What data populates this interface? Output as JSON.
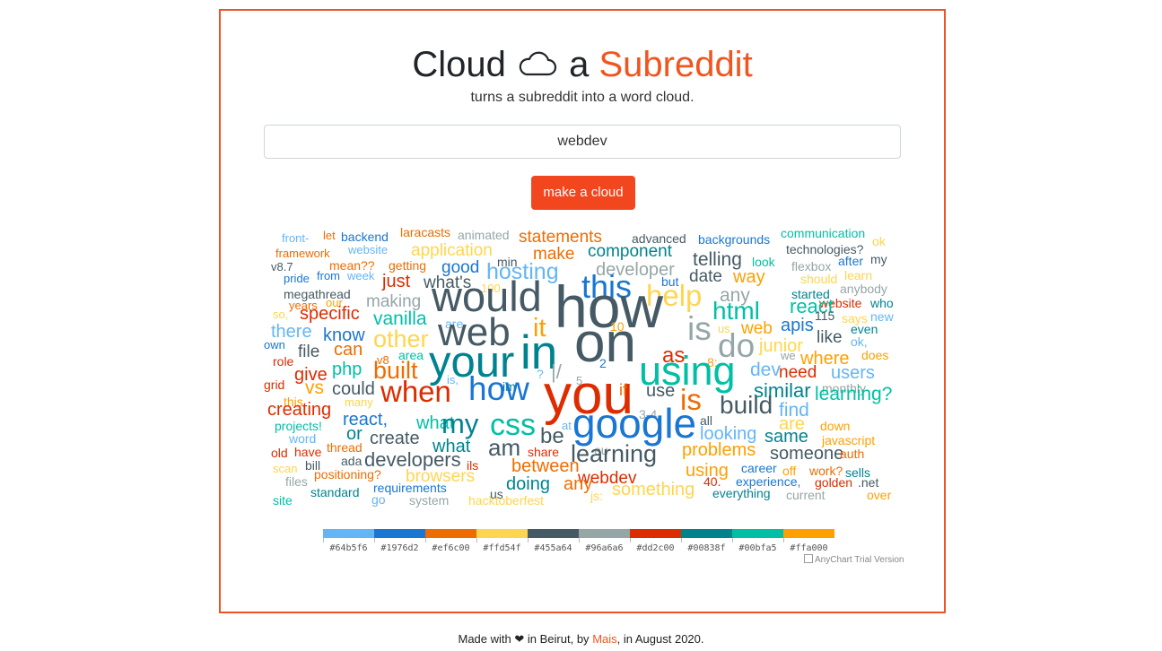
{
  "header": {
    "title_prefix": "Cloud",
    "title_mid": "a",
    "title_accent": "Subreddit",
    "cloud_icon": "cloud-icon",
    "subtitle": "turns a subreddit into a word cloud."
  },
  "search": {
    "value": "webdev"
  },
  "make_button_label": "make a cloud",
  "colors": {
    "accent": "#ef5223",
    "button": "#f1461e",
    "palette": [
      "#64b5f6",
      "#1976d2",
      "#ef6c00",
      "#ffd54f",
      "#455a64",
      "#96a6a6",
      "#dd2c00",
      "#00838f",
      "#00bfa5",
      "#ffa000"
    ]
  },
  "legend": {
    "labels": [
      "#64b5f6",
      "#1976d2",
      "#ef6c00",
      "#ffd54f",
      "#455a64",
      "#96a6a6",
      "#dd2c00",
      "#00838f",
      "#00bfa5",
      "#ffa000"
    ],
    "credit": "AnyChart Trial Version"
  },
  "word_cloud": [
    {
      "t": "front-",
      "c": "#64b5f6"
    },
    {
      "t": "framework",
      "c": "#ef6c00"
    },
    {
      "t": "let",
      "c": "#ef6c00"
    },
    {
      "t": "backend",
      "c": "#1976d2"
    },
    {
      "t": "website",
      "c": "#64b5f6"
    },
    {
      "t": "laracasts",
      "c": "#ef6c00"
    },
    {
      "t": "animated",
      "c": "#96a6a6"
    },
    {
      "t": "statements",
      "c": "#ef6c00"
    },
    {
      "t": "advanced",
      "c": "#455a64"
    },
    {
      "t": "backgrounds",
      "c": "#1976d2"
    },
    {
      "t": "communication",
      "c": "#00bfa5"
    },
    {
      "t": "ok",
      "c": "#ffd54f"
    },
    {
      "t": "application",
      "c": "#ffd54f"
    },
    {
      "t": "make",
      "c": "#ef6c00"
    },
    {
      "t": "component",
      "c": "#00838f"
    },
    {
      "t": "technologies?",
      "c": "#455a64"
    },
    {
      "t": "my",
      "c": "#455a64"
    },
    {
      "t": "v8.7",
      "c": "#455a64"
    },
    {
      "t": "mean??",
      "c": "#ef6c00"
    },
    {
      "t": "getting",
      "c": "#ef6c00"
    },
    {
      "t": "min",
      "c": "#455a64"
    },
    {
      "t": "telling",
      "c": "#455a64"
    },
    {
      "t": "look",
      "c": "#00bfa5"
    },
    {
      "t": "after",
      "c": "#1976d2"
    },
    {
      "t": "pride",
      "c": "#1976d2"
    },
    {
      "t": "from",
      "c": "#1976d2"
    },
    {
      "t": "week",
      "c": "#64b5f6"
    },
    {
      "t": "good",
      "c": "#1976d2"
    },
    {
      "t": "hosting",
      "c": "#64b5f6"
    },
    {
      "t": "developer",
      "c": "#96a6a6"
    },
    {
      "t": "flexbox",
      "c": "#96a6a6"
    },
    {
      "t": "learn",
      "c": "#ffd54f"
    },
    {
      "t": "just",
      "c": "#dd2c00"
    },
    {
      "t": "what's",
      "c": "#455a64"
    },
    {
      "t": "100",
      "c": "#ffd54f"
    },
    {
      "t": "date",
      "c": "#455a64"
    },
    {
      "t": "way",
      "c": "#ffa000"
    },
    {
      "t": "should",
      "c": "#ffd54f"
    },
    {
      "t": "megathread",
      "c": "#455a64"
    },
    {
      "t": "this",
      "c": "#1976d2"
    },
    {
      "t": "but",
      "c": "#1976d2"
    },
    {
      "t": "anybody",
      "c": "#96a6a6"
    },
    {
      "t": "years",
      "c": "#ef6c00"
    },
    {
      "t": "our",
      "c": "#ffa000"
    },
    {
      "t": "making",
      "c": "#96a6a6"
    },
    {
      "t": "would",
      "c": "#455a64"
    },
    {
      "t": "help",
      "c": "#ffd54f"
    },
    {
      "t": "any",
      "c": "#96a6a6"
    },
    {
      "t": "started",
      "c": "#00838f"
    },
    {
      "t": "website",
      "c": "#dd2c00"
    },
    {
      "t": "who",
      "c": "#00838f"
    },
    {
      "t": "so,",
      "c": "#ffd54f"
    },
    {
      "t": "specific",
      "c": "#dd2c00"
    },
    {
      "t": "vanilla",
      "c": "#00bfa5"
    },
    {
      "t": "html",
      "c": "#00bfa5"
    },
    {
      "t": "react",
      "c": "#00bfa5"
    },
    {
      "t": "115",
      "c": "#455a64"
    },
    {
      "t": "says",
      "c": "#ffd54f"
    },
    {
      "t": "new",
      "c": "#64b5f6"
    },
    {
      "t": "there",
      "c": "#64b5f6"
    },
    {
      "t": "are",
      "c": "#64b5f6"
    },
    {
      "t": "how",
      "c": "#455a64"
    },
    {
      "t": "10",
      "c": "#ffa000"
    },
    {
      "t": "us",
      "c": "#ffd54f"
    },
    {
      "t": "web",
      "c": "#ffa000"
    },
    {
      "t": "apis",
      "c": "#1976d2"
    },
    {
      "t": "even",
      "c": "#00838f"
    },
    {
      "t": "know",
      "c": "#1976d2"
    },
    {
      "t": "other",
      "c": "#ffd54f"
    },
    {
      "t": "web",
      "c": "#455a64"
    },
    {
      "t": "it",
      "c": "#ffa000"
    },
    {
      "t": "is",
      "c": "#96a6a6"
    },
    {
      "t": "like",
      "c": "#455a64"
    },
    {
      "t": "ok,",
      "c": "#64b5f6"
    },
    {
      "t": "own",
      "c": "#1976d2"
    },
    {
      "t": "file",
      "c": "#455a64"
    },
    {
      "t": "can",
      "c": "#ef6c00"
    },
    {
      "t": "junior",
      "c": "#ffd54f"
    },
    {
      "t": "do",
      "c": "#96a6a6"
    },
    {
      "t": "on",
      "c": "#455a64"
    },
    {
      "t": "in",
      "c": "#00838f"
    },
    {
      "t": "we",
      "c": "#96a6a6"
    },
    {
      "t": "does",
      "c": "#ffa000"
    },
    {
      "t": "role",
      "c": "#dd2c00"
    },
    {
      "t": "area",
      "c": "#00bfa5"
    },
    {
      "t": "v8",
      "c": "#ef6c00"
    },
    {
      "t": "as",
      "c": "#dd2c00"
    },
    {
      "t": "where",
      "c": "#ffa000"
    },
    {
      "t": "8:",
      "c": "#ffa000"
    },
    {
      "t": "built",
      "c": "#ef6c00"
    },
    {
      "t": "php",
      "c": "#00bfa5"
    },
    {
      "t": "your",
      "c": "#00838f"
    },
    {
      "t": "2",
      "c": "#1976d2"
    },
    {
      "t": "using",
      "c": "#00bfa5"
    },
    {
      "t": "dev",
      "c": "#64b5f6"
    },
    {
      "t": "users",
      "c": "#64b5f6"
    },
    {
      "t": "give",
      "c": "#dd2c00"
    },
    {
      "t": "grid",
      "c": "#dd2c00"
    },
    {
      "t": "vs",
      "c": "#ffa000"
    },
    {
      "t": "is,",
      "c": "#64b5f6"
    },
    {
      "t": "?",
      "c": "#64b5f6"
    },
    {
      "t": "|/",
      "c": "#96a6a6"
    },
    {
      "t": "5",
      "c": "#96a6a6"
    },
    {
      "t": "need",
      "c": "#dd2c00"
    },
    {
      "t": "monthly",
      "c": "#96a6a6"
    },
    {
      "t": "this",
      "c": "#ffa000"
    },
    {
      "t": "could",
      "c": "#455a64"
    },
    {
      "t": "im",
      "c": "#00838f"
    },
    {
      "t": "when",
      "c": "#dd2c00"
    },
    {
      "t": "how",
      "c": "#1976d2"
    },
    {
      "t": "you",
      "c": "#dd2c00"
    },
    {
      "t": "if",
      "c": "#ef6c00"
    },
    {
      "t": "use",
      "c": "#455a64"
    },
    {
      "t": "is",
      "c": "#ef6c00"
    },
    {
      "t": "similar",
      "c": "#00838f"
    },
    {
      "t": "learning?",
      "c": "#00bfa5"
    },
    {
      "t": "many",
      "c": "#ffd54f"
    },
    {
      "t": "creating",
      "c": "#dd2c00"
    },
    {
      "t": "find",
      "c": "#64b5f6"
    },
    {
      "t": "3-4",
      "c": "#96a6a6"
    },
    {
      "t": "build",
      "c": "#455a64"
    },
    {
      "t": "react,",
      "c": "#1976d2"
    },
    {
      "t": "what",
      "c": "#00bfa5"
    },
    {
      "t": "my",
      "c": "#00838f"
    },
    {
      "t": "css",
      "c": "#00bfa5"
    },
    {
      "t": "google",
      "c": "#1976d2"
    },
    {
      "t": "all",
      "c": "#455a64"
    },
    {
      "t": "projects!",
      "c": "#00bfa5"
    },
    {
      "t": "or",
      "c": "#00838f"
    },
    {
      "t": "at",
      "c": "#64b5f6"
    },
    {
      "t": "are",
      "c": "#ffd54f"
    },
    {
      "t": "down",
      "c": "#ffa000"
    },
    {
      "t": "create",
      "c": "#455a64"
    },
    {
      "t": "be",
      "c": "#455a64"
    },
    {
      "t": "looking",
      "c": "#64b5f6"
    },
    {
      "t": "same",
      "c": "#00838f"
    },
    {
      "t": "javascript",
      "c": "#ffa000"
    },
    {
      "t": "word",
      "c": "#64b5f6"
    },
    {
      "t": "what",
      "c": "#00838f"
    },
    {
      "t": "am",
      "c": "#455a64"
    },
    {
      "t": "eu",
      "c": "#96a6a6"
    },
    {
      "t": "problems",
      "c": "#ffa000"
    },
    {
      "t": "old",
      "c": "#dd2c00"
    },
    {
      "t": "have",
      "c": "#dd2c00"
    },
    {
      "t": "thread",
      "c": "#ef6c00"
    },
    {
      "t": "share",
      "c": "#dd2c00"
    },
    {
      "t": "learning",
      "c": "#455a64"
    },
    {
      "t": "someone",
      "c": "#455a64"
    },
    {
      "t": "auth",
      "c": "#ef6c00"
    },
    {
      "t": "developers",
      "c": "#455a64"
    },
    {
      "t": "ada",
      "c": "#455a64"
    },
    {
      "t": "scan",
      "c": "#ffd54f"
    },
    {
      "t": "bill",
      "c": "#455a64"
    },
    {
      "t": "ils",
      "c": "#dd2c00"
    },
    {
      "t": "between",
      "c": "#ef6c00"
    },
    {
      "t": "career",
      "c": "#1976d2"
    },
    {
      "t": "off",
      "c": "#ffa000"
    },
    {
      "t": "work?",
      "c": "#ef6c00"
    },
    {
      "t": "sells",
      "c": "#00838f"
    },
    {
      "t": "using",
      "c": "#ffa000"
    },
    {
      "t": "positioning?",
      "c": "#ef6c00"
    },
    {
      "t": "browsers",
      "c": "#ffd54f"
    },
    {
      "t": "webdev",
      "c": "#dd2c00"
    },
    {
      "t": "experience,",
      "c": "#1976d2"
    },
    {
      "t": "golden",
      "c": "#dd2c00"
    },
    {
      "t": ".net",
      "c": "#455a64"
    },
    {
      "t": "files",
      "c": "#96a6a6"
    },
    {
      "t": "requirements",
      "c": "#1976d2"
    },
    {
      "t": "doing",
      "c": "#00838f"
    },
    {
      "t": "40.",
      "c": "#dd2c00"
    },
    {
      "t": "us",
      "c": "#455a64"
    },
    {
      "t": "any",
      "c": "#ef6c00"
    },
    {
      "t": "js:",
      "c": "#ffd54f"
    },
    {
      "t": "something",
      "c": "#ffd54f"
    },
    {
      "t": "everything",
      "c": "#00838f"
    },
    {
      "t": "current",
      "c": "#96a6a6"
    },
    {
      "t": "over",
      "c": "#ffa000"
    },
    {
      "t": "standard",
      "c": "#00838f"
    },
    {
      "t": "go",
      "c": "#64b5f6"
    },
    {
      "t": "system",
      "c": "#96a6a6"
    },
    {
      "t": "hacktoberfest",
      "c": "#ffd54f"
    },
    {
      "t": "site",
      "c": "#00bfa5"
    }
  ],
  "footer": {
    "prefix": "Made with",
    "heart_icon": "heart-icon",
    "middle": "in Beirut, by",
    "author": "Mais",
    "suffix": ", in August 2020."
  }
}
